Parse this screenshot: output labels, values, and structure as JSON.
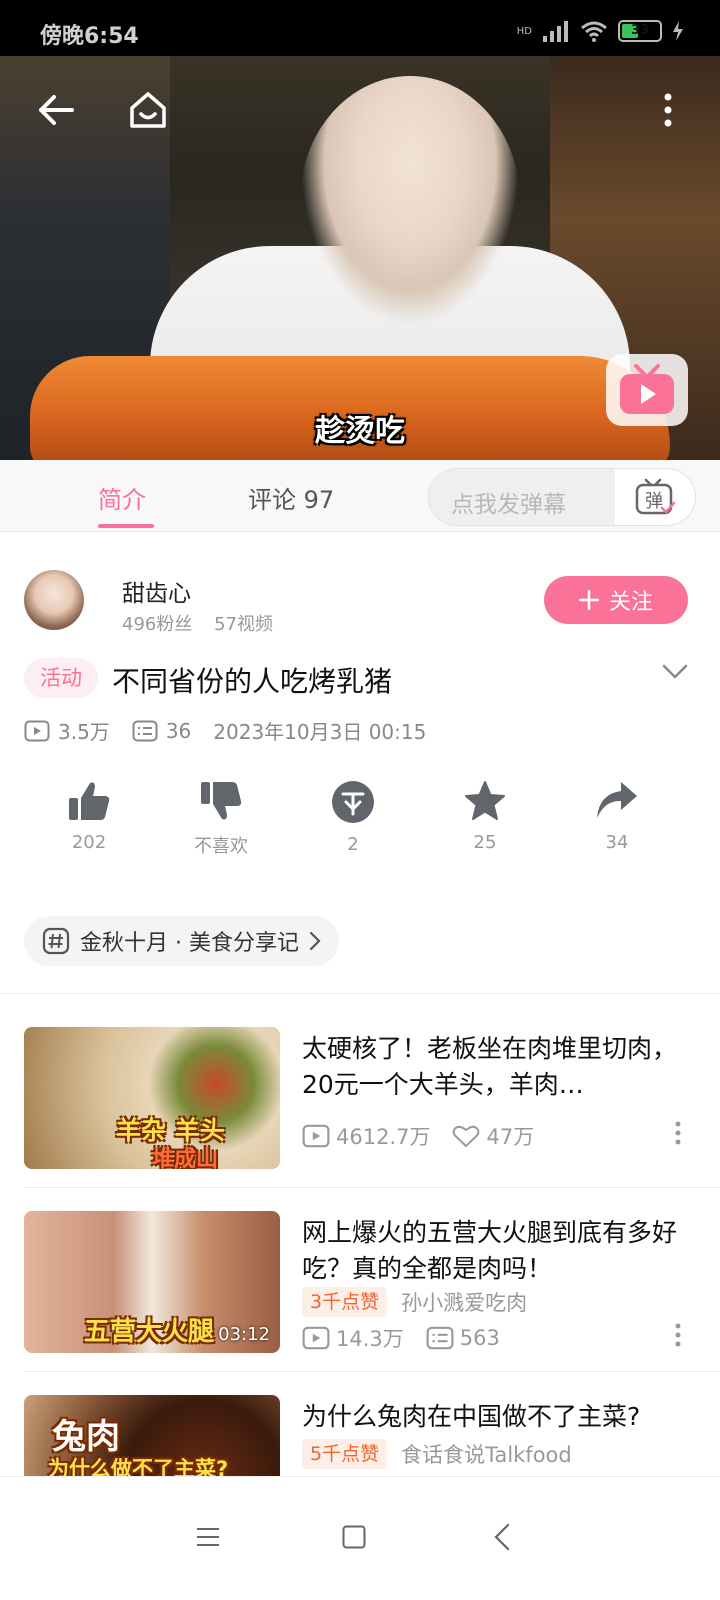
{
  "status_bar": {
    "time": "傍晚6:54",
    "battery": "33",
    "network": "HD"
  },
  "video": {
    "subtitle": "趁烫吃"
  },
  "tabs": [
    {
      "label": "简介",
      "active": true
    },
    {
      "label": "评论 97",
      "active": false
    }
  ],
  "danmaku": {
    "placeholder": "点我发弹幕",
    "button_label": "弹"
  },
  "uploader": {
    "name": "甜齿心",
    "fans": "496粉丝",
    "videos": "57视频",
    "follow_label": "关注"
  },
  "video_info": {
    "tag": "活动",
    "title": "不同省份的人吃烤乳猪",
    "plays": "3.5万",
    "danmaku_count": "36",
    "date": "2023年10月3日 00:15"
  },
  "actions": [
    {
      "icon": "thumbs-up-icon",
      "label": "202"
    },
    {
      "icon": "thumbs-down-icon",
      "label": "不喜欢"
    },
    {
      "icon": "coin-icon",
      "label": "2"
    },
    {
      "icon": "star-icon",
      "label": "25"
    },
    {
      "icon": "share-icon",
      "label": "34"
    }
  ],
  "topic": {
    "label": "金秋十月 · 美食分享记"
  },
  "recommendations": [
    {
      "title": "太硬核了！老板坐在肉堆里切肉，20元一个大羊头，羊肉…",
      "thumb_text": [
        "羊杂 羊头",
        "堆成山"
      ],
      "plays": "4612.7万",
      "likes": "47万"
    },
    {
      "title": "网上爆火的五营大火腿到底有多好吃？真的全都是肉吗！",
      "thumb_text": [
        "五营大火腿"
      ],
      "duration": "03:12",
      "badge": "3千点赞",
      "author": "孙小溅爱吃肉",
      "plays": "14.3万",
      "danmaku": "563"
    },
    {
      "title": "为什么兔肉在中国做不了主菜?",
      "thumb_text": [
        "兔肉",
        "为什么做不了主菜?"
      ],
      "badge": "5千点赞",
      "author": "食话食说Talkfood"
    }
  ],
  "colors": {
    "accent": "#fb7299",
    "badge_orange": "#f0652d"
  }
}
